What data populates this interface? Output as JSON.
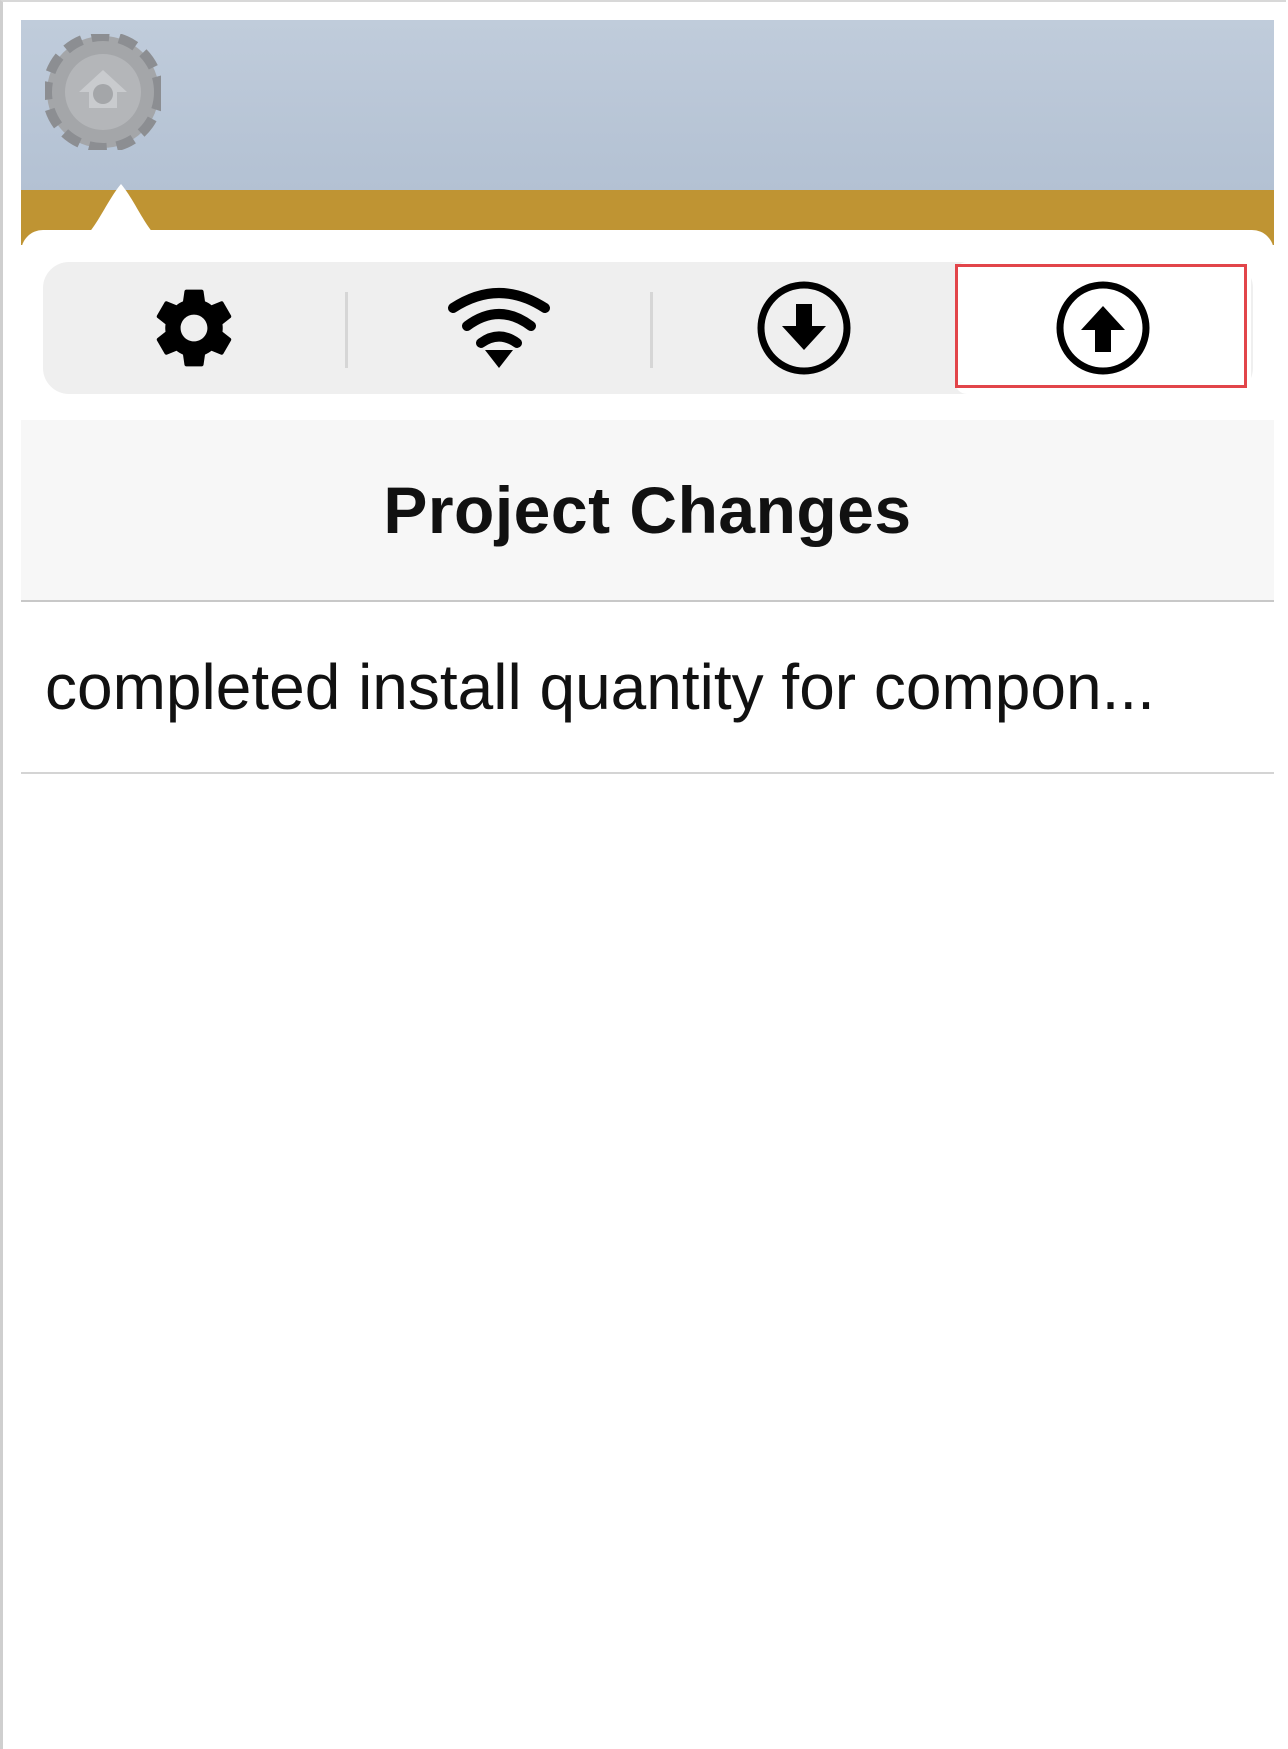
{
  "header": {
    "logo_icon": "app-logo-icon",
    "background_color": "#b8c5d6",
    "band_color": "#bf9433"
  },
  "segmented_control": {
    "items": [
      {
        "icon": "gear-icon",
        "label": "Settings",
        "selected": false
      },
      {
        "icon": "wifi-icon",
        "label": "Connectivity",
        "selected": false
      },
      {
        "icon": "download-icon",
        "label": "Download",
        "selected": false
      },
      {
        "icon": "upload-icon",
        "label": "Upload",
        "selected": true
      }
    ],
    "highlight_color": "#e2454a"
  },
  "panel": {
    "title": "Project Changes",
    "changes": [
      {
        "text": "completed install quantity for compon..."
      }
    ]
  }
}
